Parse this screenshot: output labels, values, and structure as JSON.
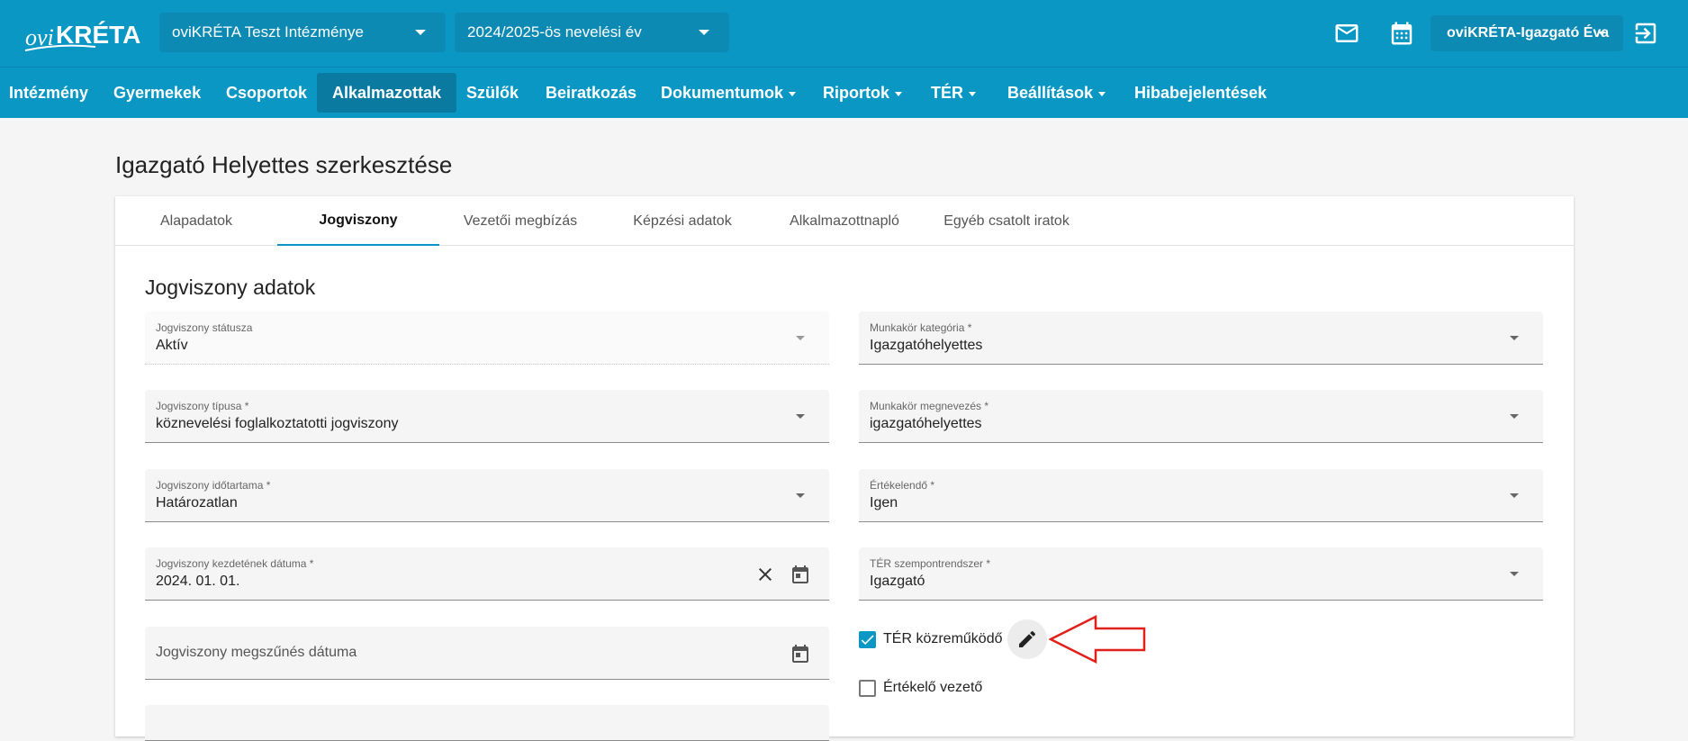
{
  "header": {
    "logo_text": "oviKRÉTA",
    "institution_select": "oviKRÉTA Teszt Intézménye",
    "year_select": "2024/2025-ös nevelési év",
    "user_name": "oviKRÉTA-Igazgató Éva"
  },
  "nav": {
    "items": [
      {
        "label": "Intézmény"
      },
      {
        "label": "Gyermekek"
      },
      {
        "label": "Csoportok"
      },
      {
        "label": "Alkalmazottak"
      },
      {
        "label": "Szülők"
      },
      {
        "label": "Beiratkozás"
      },
      {
        "label": "Dokumentumok"
      },
      {
        "label": "Riportok"
      },
      {
        "label": "TÉR"
      },
      {
        "label": "Beállítások"
      },
      {
        "label": "Hibabejelentések"
      }
    ]
  },
  "page": {
    "title": "Igazgató Helyettes szerkesztése"
  },
  "tabs": [
    {
      "label": "Alapadatok"
    },
    {
      "label": "Jogviszony"
    },
    {
      "label": "Vezetői megbízás"
    },
    {
      "label": "Képzési adatok"
    },
    {
      "label": "Alkalmazottnapló"
    },
    {
      "label": "Egyéb csatolt iratok"
    }
  ],
  "form": {
    "section_title": "Jogviszony adatok",
    "fields": {
      "status": {
        "label": "Jogviszony státusza",
        "value": "Aktív"
      },
      "type": {
        "label": "Jogviszony típusa *",
        "value": "köznevelési foglalkoztatotti jogviszony"
      },
      "duration": {
        "label": "Jogviszony időtartama *",
        "value": "Határozatlan"
      },
      "start_date": {
        "label": "Jogviszony kezdetének dátuma *",
        "value": "2024. 01. 01."
      },
      "end_date": {
        "placeholder": "Jogviszony megszűnés dátuma"
      },
      "job_category": {
        "label": "Munkakör kategória *",
        "value": "Igazgatóhelyettes"
      },
      "job_title": {
        "label": "Munkakör megnevezés *",
        "value": "igazgatóhelyettes"
      },
      "evaluated": {
        "label": "Értékelendő *",
        "value": "Igen"
      },
      "ter_system": {
        "label": "TÉR szempontrendszer *",
        "value": "Igazgató"
      }
    },
    "checkboxes": {
      "ter_contributor": {
        "label": "TÉR közreműködő",
        "checked": true
      },
      "evaluator_leader": {
        "label": "Értékelő vezető",
        "checked": false
      }
    }
  },
  "colors": {
    "brand": "#0a97c4",
    "annotation": "#e0201b"
  }
}
